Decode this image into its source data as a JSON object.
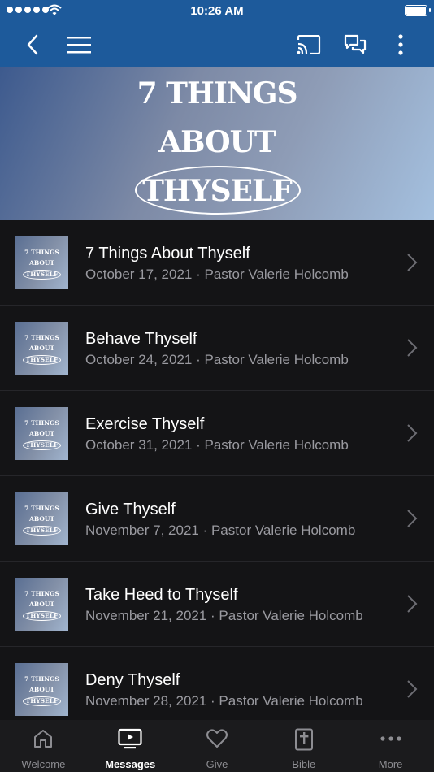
{
  "status": {
    "time": "10:26 AM"
  },
  "navbar": {
    "back_icon": "chevron-left-icon",
    "menu_icon": "hamburger-icon",
    "cast_icon": "cast-icon",
    "chat_icon": "chat-bubbles-icon",
    "more_icon": "vertical-dots-icon"
  },
  "hero": {
    "line1": "7 THINGS",
    "line2": "ABOUT",
    "line3": "THYSELF"
  },
  "thumb": {
    "line1": "7 THINGS",
    "line2": "ABOUT",
    "line3": "THYSELF"
  },
  "messages": [
    {
      "title": "7 Things About Thyself",
      "subtitle": "October 17, 2021 · Pastor Valerie Holcomb"
    },
    {
      "title": "Behave Thyself",
      "subtitle": "October 24, 2021 · Pastor Valerie Holcomb"
    },
    {
      "title": "Exercise Thyself",
      "subtitle": "October 31, 2021 · Pastor Valerie Holcomb"
    },
    {
      "title": "Give Thyself",
      "subtitle": "November 7, 2021 · Pastor Valerie Holcomb"
    },
    {
      "title": "Take Heed to Thyself",
      "subtitle": "November 21, 2021 · Pastor Valerie Holcomb"
    },
    {
      "title": "Deny Thyself",
      "subtitle": "November 28, 2021 · Pastor Valerie Holcomb"
    }
  ],
  "tabs": [
    {
      "label": "Welcome",
      "icon": "home-icon"
    },
    {
      "label": "Messages",
      "icon": "video-player-icon",
      "active": true
    },
    {
      "label": "Give",
      "icon": "heart-icon"
    },
    {
      "label": "Bible",
      "icon": "bible-icon"
    },
    {
      "label": "More",
      "icon": "more-dots-icon"
    }
  ],
  "colors": {
    "navbar": "#1d5a9b",
    "background": "#141416",
    "tabbar": "#1b1b1d"
  }
}
